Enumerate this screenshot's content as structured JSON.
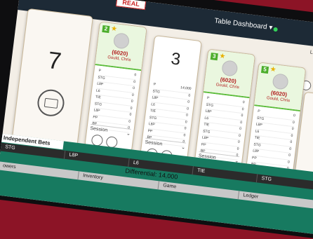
{
  "header": {
    "real_label": "REAL",
    "dashboard": "Table Dashboard ▾",
    "limits": "Limits"
  },
  "shoe": {
    "number": "7"
  },
  "seats": [
    {
      "num": "2",
      "balance": "(6020)",
      "name": "Gould, Chris",
      "active": true
    },
    {
      "num": "",
      "seatnum": "3",
      "balance": "",
      "name": "",
      "active": false
    },
    {
      "num": "3",
      "balance": "(6020)",
      "name": "Gould, Chris",
      "active": true
    },
    {
      "num": "5",
      "balance": "(6020)",
      "name": "Gould, Chris",
      "active": true
    }
  ],
  "rows": [
    "P",
    "STG",
    "L8P",
    "L6",
    "TIE",
    "STG",
    "L8P",
    "PP",
    "BP"
  ],
  "row_values": [
    "0",
    "0",
    "0",
    "0",
    "0",
    "0",
    "0",
    "0",
    "0"
  ],
  "seat3_value": "14,000",
  "session": "Session",
  "right_shoe": "7",
  "bottom": {
    "independent": "Independent Bets",
    "bets": [
      "STG",
      "L8P",
      "L6",
      "TIE",
      "STG"
    ],
    "differential": "Differential: 14,000",
    "inventory": [
      "owers",
      "Inventory",
      "Game",
      "Ledger"
    ]
  }
}
